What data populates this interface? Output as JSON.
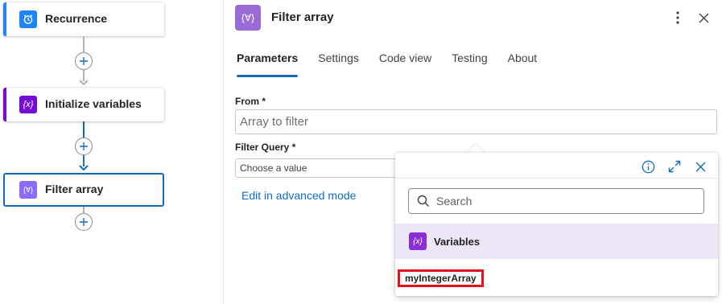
{
  "workflow": {
    "nodes": [
      {
        "label": "Recurrence",
        "icon": "alarm-clock-icon",
        "color": "#1f85ff"
      },
      {
        "label": "Initialize variables",
        "icon": "variable-icon",
        "color": "#770bd6"
      },
      {
        "label": "Filter array",
        "icon": "filter-array-icon",
        "color": "#8c6cff"
      }
    ]
  },
  "panel": {
    "title": "Filter array",
    "tabs": [
      "Parameters",
      "Settings",
      "Code view",
      "Testing",
      "About"
    ],
    "active_tab": "Parameters",
    "from": {
      "label": "From *",
      "placeholder": "Array to filter"
    },
    "filter_query": {
      "label": "Filter Query *",
      "placeholder": "Choose a value"
    },
    "advanced_link": "Edit in advanced mode"
  },
  "popup": {
    "search_placeholder": "Search",
    "category": "Variables",
    "item": "myIntegerArray"
  },
  "colors": {
    "accent": "#0f6cbd",
    "highlight_border": "#e3101e",
    "category_bg": "#ede6f7"
  }
}
